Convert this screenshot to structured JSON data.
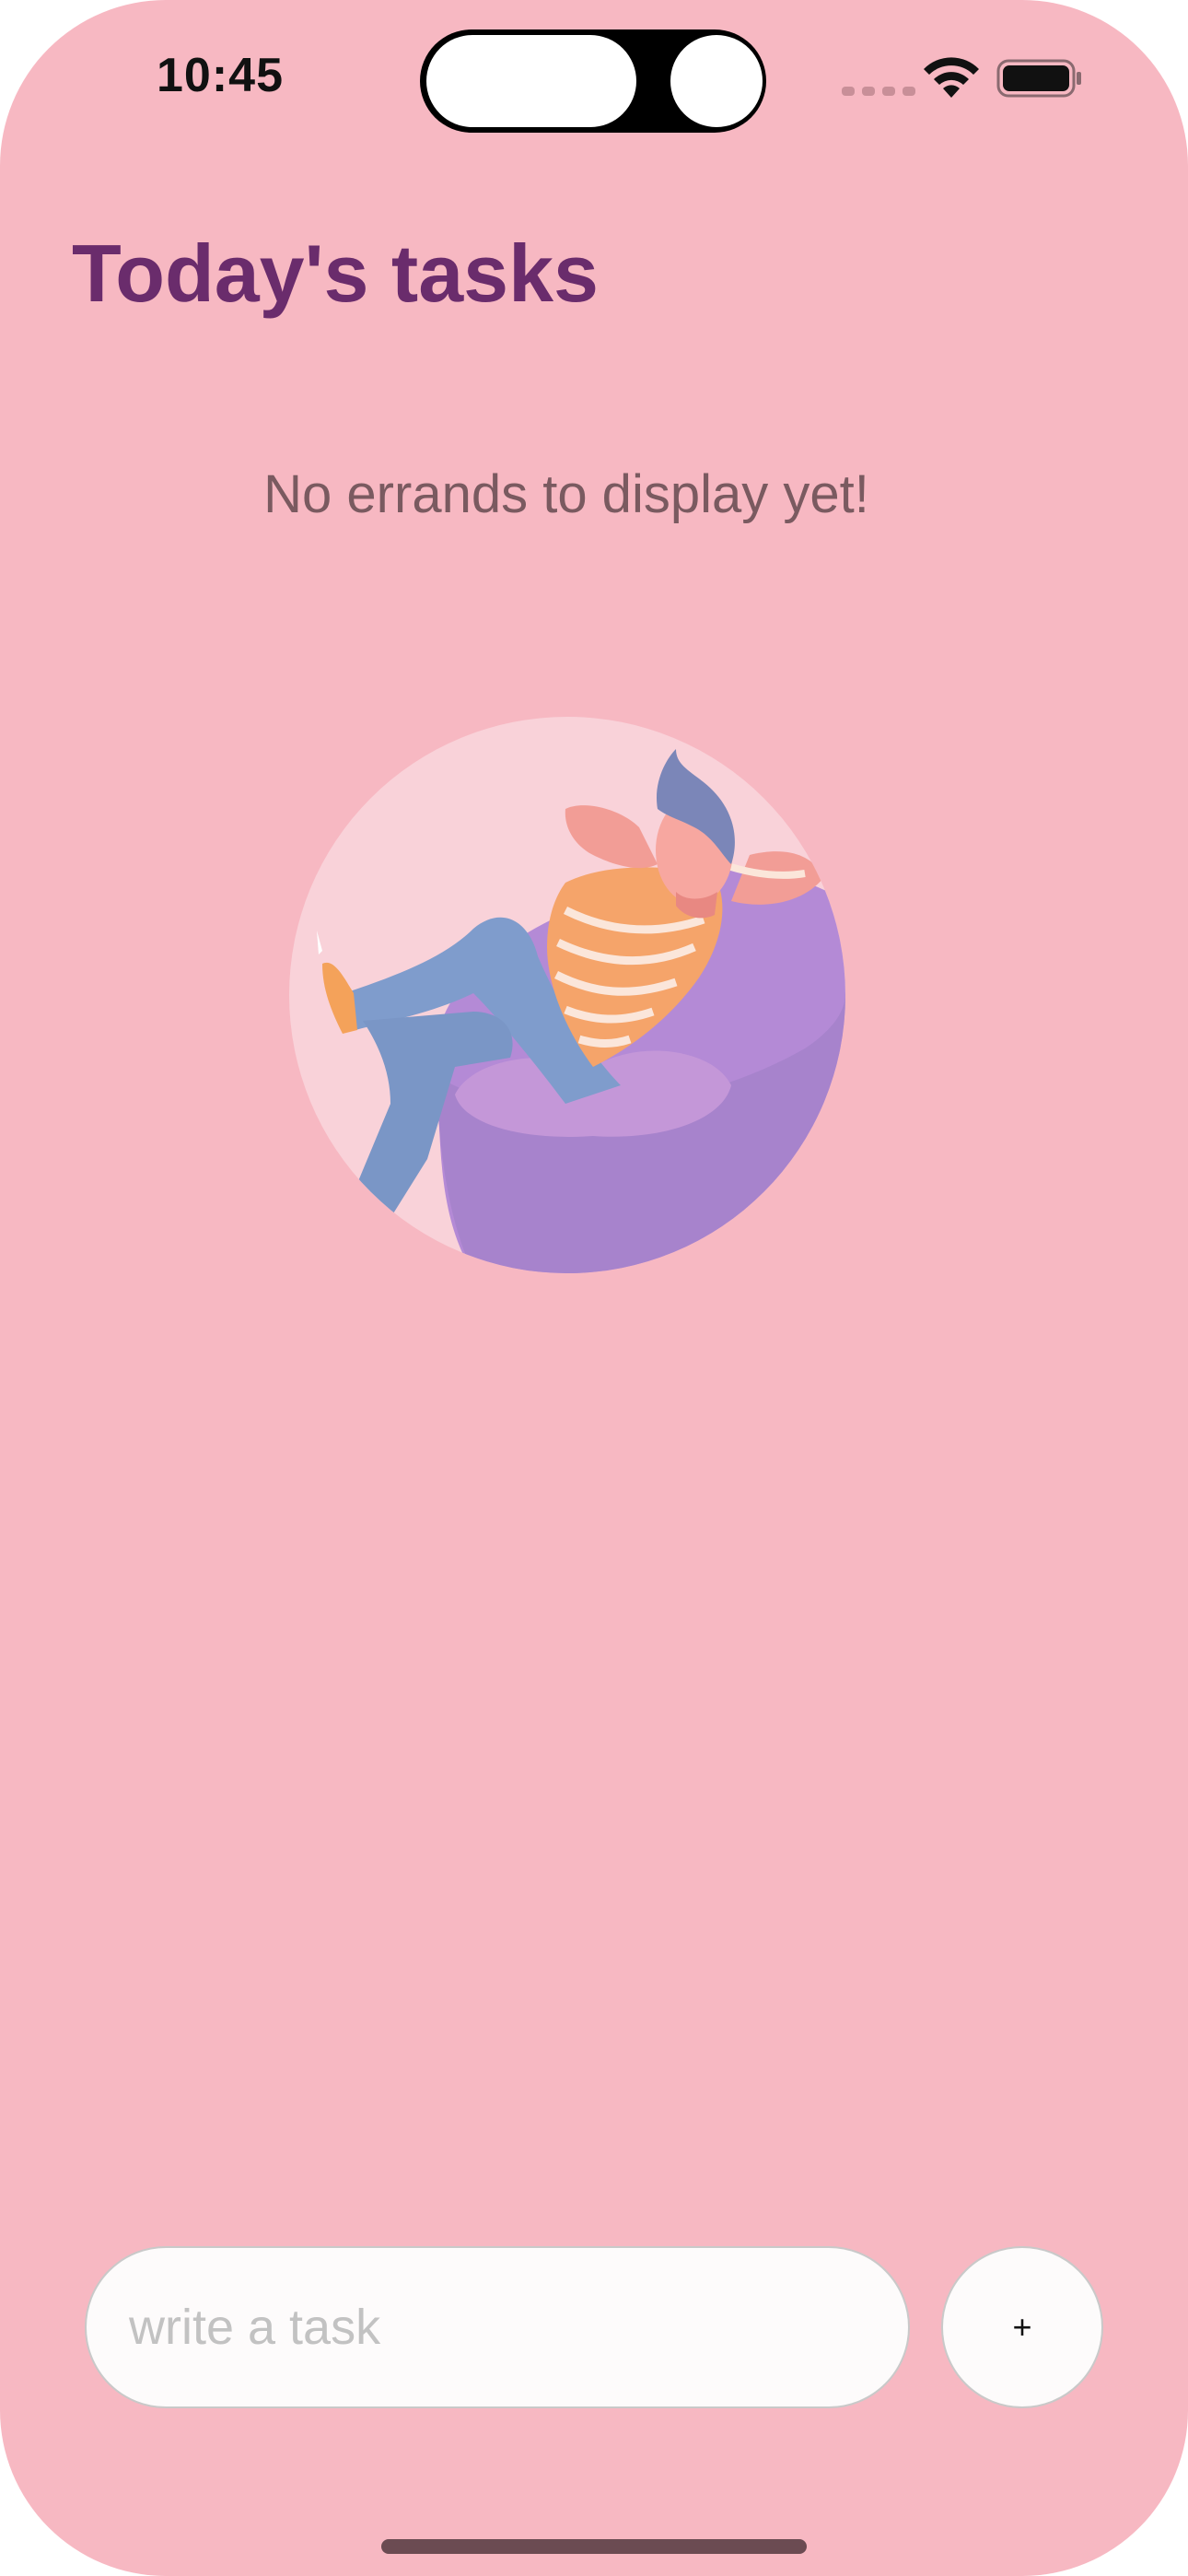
{
  "status_bar": {
    "time": "10:45"
  },
  "header": {
    "title": "Today's tasks"
  },
  "empty_state": {
    "message": "No errands to display yet!",
    "illustration": "man-relaxing-on-beanbag-illustration"
  },
  "composer": {
    "placeholder": "write a task",
    "value": "",
    "add_label": "+"
  },
  "icons": {
    "wifi": "wifi-icon",
    "battery": "battery-icon",
    "signal": "cellular-signal-icon"
  },
  "colors": {
    "background": "#f7b8c2",
    "title": "#6a2c6c",
    "message": "#7a5a60",
    "input_background": "#fdfbfb",
    "home_indicator": "#6b4b52"
  }
}
